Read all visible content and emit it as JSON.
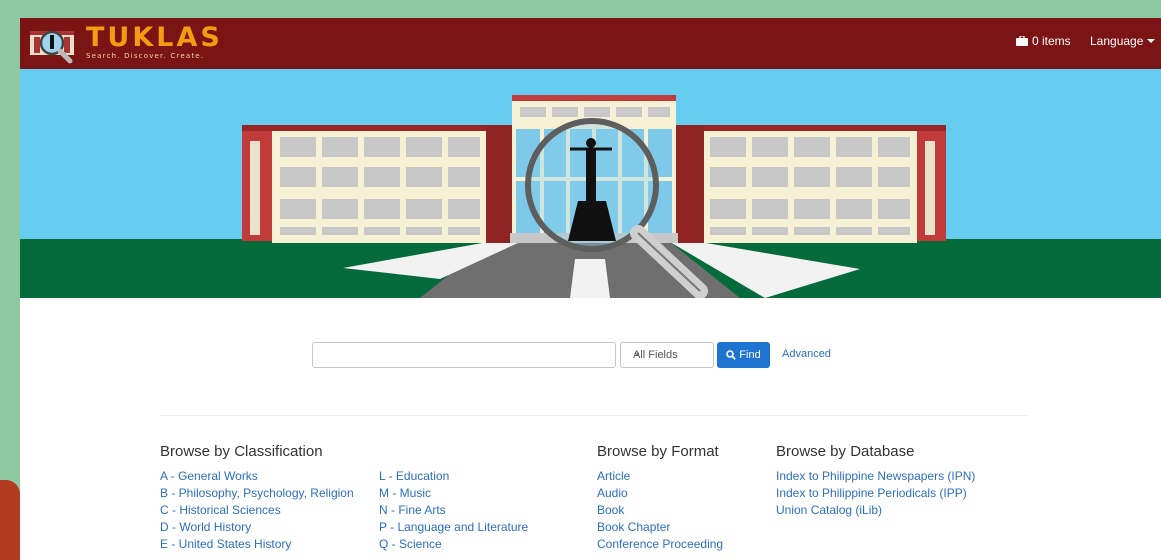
{
  "header": {
    "logo_title": "TUKLAS",
    "logo_tagline": "Search. Discover. Create.",
    "cart_label": "0 items",
    "language_label": "Language",
    "brand_color": "#7b1414",
    "logo_color": "#f39c12"
  },
  "search": {
    "query_value": "",
    "field_selected": "All Fields",
    "find_label": "Find",
    "advanced_label": "Advanced",
    "accent_color": "#1f74d1"
  },
  "browse": {
    "classification": {
      "heading": "Browse by Classification",
      "col1": [
        "A - General Works",
        "B - Philosophy, Psychology, Religion",
        "C - Historical Sciences",
        "D - World History",
        "E - United States History"
      ],
      "col2": [
        "L - Education",
        "M - Music",
        "N - Fine Arts",
        "P - Language and Literature",
        "Q - Science"
      ]
    },
    "format": {
      "heading": "Browse by Format",
      "items": [
        "Article",
        "Audio",
        "Book",
        "Book Chapter",
        "Conference Proceeding"
      ]
    },
    "database": {
      "heading": "Browse by Database",
      "items": [
        "Index to Philippine Newspapers (IPN)",
        "Index to Philippine Periodicals (IPP)",
        "Union Catalog (iLib)"
      ]
    },
    "link_color": "#2c6ec5"
  },
  "icons": {
    "logo": "magnifier-building-logo",
    "cart": "briefcase-icon",
    "language": "caret-down-icon",
    "find": "search-icon",
    "select": "chevron-down-icon"
  }
}
